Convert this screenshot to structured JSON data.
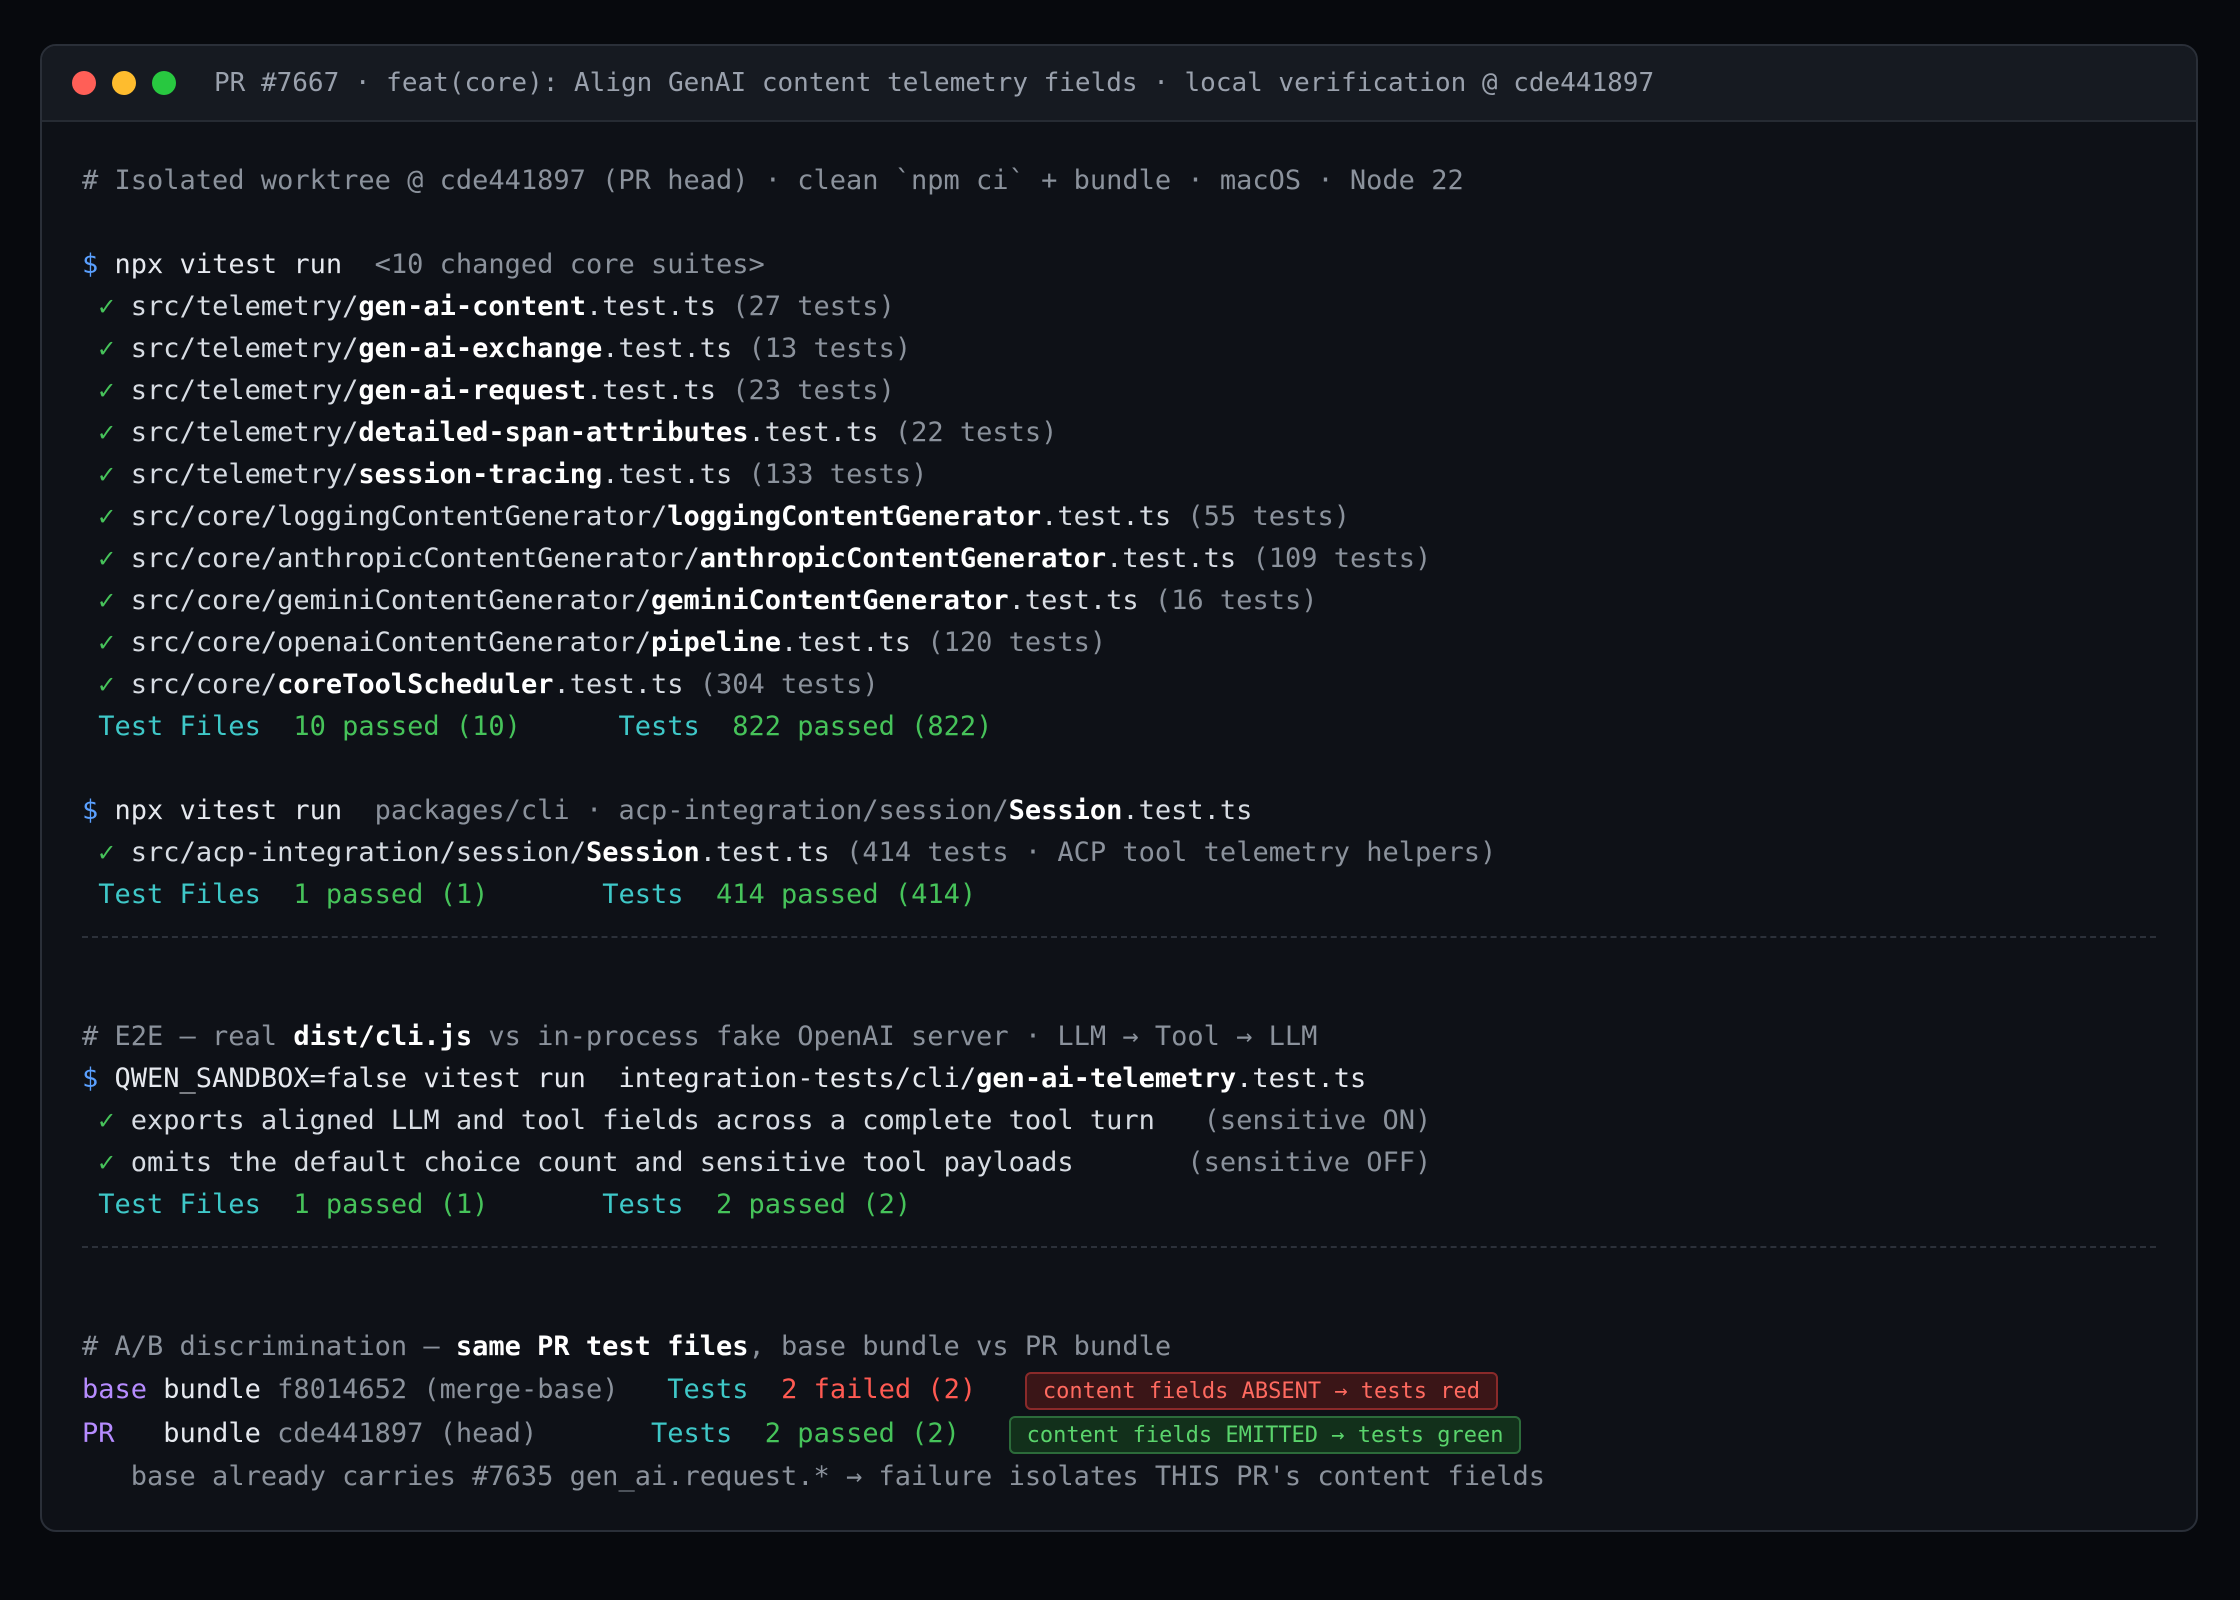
{
  "window": {
    "title": "PR #7667 · feat(core): Align GenAI content telemetry fields · local verification @ cde441897"
  },
  "header_comment": "# Isolated worktree @ cde441897 (PR head) · clean `npm ci` + bundle · macOS · Node 22",
  "run1": {
    "prompt": "$",
    "command": "npx vitest run",
    "args": "<10 changed core suites>",
    "results": [
      {
        "check": "✓",
        "dir": "src/telemetry/",
        "name": "gen-ai-content",
        "ext": ".test.ts",
        "count": "(27 tests)"
      },
      {
        "check": "✓",
        "dir": "src/telemetry/",
        "name": "gen-ai-exchange",
        "ext": ".test.ts",
        "count": "(13 tests)"
      },
      {
        "check": "✓",
        "dir": "src/telemetry/",
        "name": "gen-ai-request",
        "ext": ".test.ts",
        "count": "(23 tests)"
      },
      {
        "check": "✓",
        "dir": "src/telemetry/",
        "name": "detailed-span-attributes",
        "ext": ".test.ts",
        "count": "(22 tests)"
      },
      {
        "check": "✓",
        "dir": "src/telemetry/",
        "name": "session-tracing",
        "ext": ".test.ts",
        "count": "(133 tests)"
      },
      {
        "check": "✓",
        "dir": "src/core/loggingContentGenerator/",
        "name": "loggingContentGenerator",
        "ext": ".test.ts",
        "count": "(55 tests)"
      },
      {
        "check": "✓",
        "dir": "src/core/anthropicContentGenerator/",
        "name": "anthropicContentGenerator",
        "ext": ".test.ts",
        "count": "(109 tests)"
      },
      {
        "check": "✓",
        "dir": "src/core/geminiContentGenerator/",
        "name": "geminiContentGenerator",
        "ext": ".test.ts",
        "count": "(16 tests)"
      },
      {
        "check": "✓",
        "dir": "src/core/openaiContentGenerator/",
        "name": "pipeline",
        "ext": ".test.ts",
        "count": "(120 tests)"
      },
      {
        "check": "✓",
        "dir": "src/core/",
        "name": "coreToolScheduler",
        "ext": ".test.ts",
        "count": "(304 tests)"
      }
    ],
    "summary": {
      "files_label": "Test Files",
      "files_value": "10 passed (10)",
      "tests_label": "Tests",
      "tests_value": "822 passed (822)"
    }
  },
  "run2": {
    "prompt": "$",
    "command": "npx vitest run",
    "args": "packages/cli · acp-integration/session/",
    "args_bold": "Session",
    "args_ext": ".test.ts",
    "result": {
      "check": "✓",
      "dir": "src/acp-integration/session/",
      "name": "Session",
      "ext": ".test.ts",
      "count": "(414 tests · ACP tool telemetry helpers)"
    },
    "summary": {
      "files_label": "Test Files",
      "files_value": "1 passed (1)",
      "tests_label": "Tests",
      "tests_value": "414 passed (414)"
    }
  },
  "e2e": {
    "comment_pre": "# E2E — real ",
    "comment_bold": "dist/cli.js",
    "comment_post": " vs in-process fake OpenAI server · LLM → Tool → LLM",
    "prompt": "$",
    "command": "QWEN_SANDBOX=false vitest run",
    "args": "integration-tests/cli/",
    "args_bold": "gen-ai-telemetry",
    "args_ext": ".test.ts",
    "results": [
      {
        "check": "✓",
        "text": "exports aligned LLM and tool fields across a complete tool turn",
        "note": "(sensitive ON)"
      },
      {
        "check": "✓",
        "text": "omits the default choice count and sensitive tool payloads",
        "note": "(sensitive OFF)"
      }
    ],
    "summary": {
      "files_label": "Test Files",
      "files_value": "1 passed (1)",
      "tests_label": "Tests",
      "tests_value": "2 passed (2)"
    }
  },
  "ab": {
    "comment_pre": "# A/B discrimination — ",
    "comment_bold": "same PR test files",
    "comment_post": ", base bundle vs PR bundle",
    "base": {
      "label": "base",
      "bundle": "bundle",
      "ref": "f8014652 (merge-base)",
      "tests_label": "Tests",
      "tests_value": "2 failed (2)",
      "badge": "content fields ABSENT → tests red"
    },
    "pr": {
      "label": "PR",
      "bundle": "bundle",
      "ref": "cde441897 (head)",
      "tests_label": "Tests",
      "tests_value": "2 passed (2)",
      "badge": "content fields EMITTED → tests green"
    },
    "note": "base already carries #7635 gen_ai.request.* → failure isolates THIS PR's content fields"
  },
  "colors": {
    "background": "#0e1117",
    "prompt": "#5aa0ff",
    "pass": "#46c35a",
    "fail": "#ff5a52",
    "label": "#3fc8c8",
    "accent_purple": "#b68cff"
  }
}
